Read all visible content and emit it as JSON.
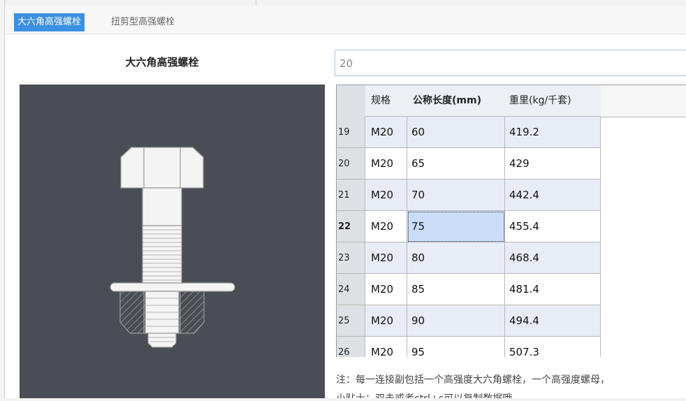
{
  "tabs": [
    {
      "label": "大六角高强螺栓",
      "active": true
    },
    {
      "label": "扭剪型高强螺栓",
      "active": false
    }
  ],
  "product": {
    "title": "大六角高强螺栓"
  },
  "search": {
    "value": "20"
  },
  "table": {
    "headers": [
      "规格",
      "公称长度(mm)",
      "重里(kg/千套)"
    ],
    "rows": [
      {
        "num": "19",
        "spec": "M20",
        "len": "60",
        "wt": "419.2"
      },
      {
        "num": "20",
        "spec": "M20",
        "len": "65",
        "wt": "429"
      },
      {
        "num": "21",
        "spec": "M20",
        "len": "70",
        "wt": "442.4"
      },
      {
        "num": "22",
        "spec": "M20",
        "len": "75",
        "wt": "455.4"
      },
      {
        "num": "23",
        "spec": "M20",
        "len": "80",
        "wt": "468.4"
      },
      {
        "num": "24",
        "spec": "M20",
        "len": "85",
        "wt": "481.4"
      },
      {
        "num": "25",
        "spec": "M20",
        "len": "90",
        "wt": "494.4"
      },
      {
        "num": "26",
        "spec": "M20",
        "len": "95",
        "wt": "507.3"
      }
    ]
  },
  "notes": {
    "line1": "注：每一连接副包括一个高强度大六角螺栓，一个高强度螺母，",
    "line2": "小贴士：双击或者ctrl+c可以复制数据哦"
  },
  "colors": {
    "accent": "#3c8fe2",
    "image_bg": "#4a4d53",
    "row_alt": "#e8ecf6",
    "selection": "#c9dcf8"
  },
  "icons": {
    "bolt": "bolt-diagram"
  }
}
